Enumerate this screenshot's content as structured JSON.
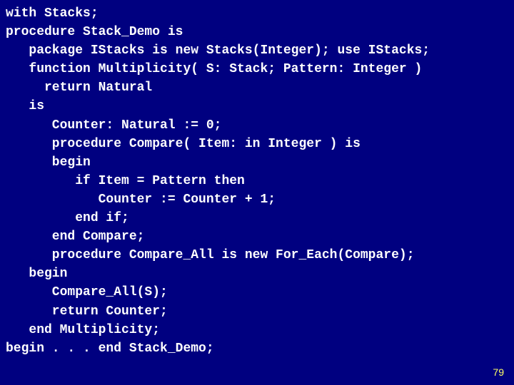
{
  "code": {
    "lines": [
      "with Stacks;",
      "procedure Stack_Demo is",
      "   package IStacks is new Stacks(Integer); use IStacks;",
      "   function Multiplicity( S: Stack; Pattern: Integer )",
      "     return Natural",
      "   is",
      "      Counter: Natural := 0;",
      "      procedure Compare( Item: in Integer ) is",
      "      begin",
      "         if Item = Pattern then",
      "            Counter := Counter + 1;",
      "         end if;",
      "      end Compare;",
      "      procedure Compare_All is new For_Each(Compare);",
      "   begin",
      "      Compare_All(S);",
      "      return Counter;",
      "   end Multiplicity;",
      "begin . . . end Stack_Demo;"
    ]
  },
  "page_number": "79"
}
